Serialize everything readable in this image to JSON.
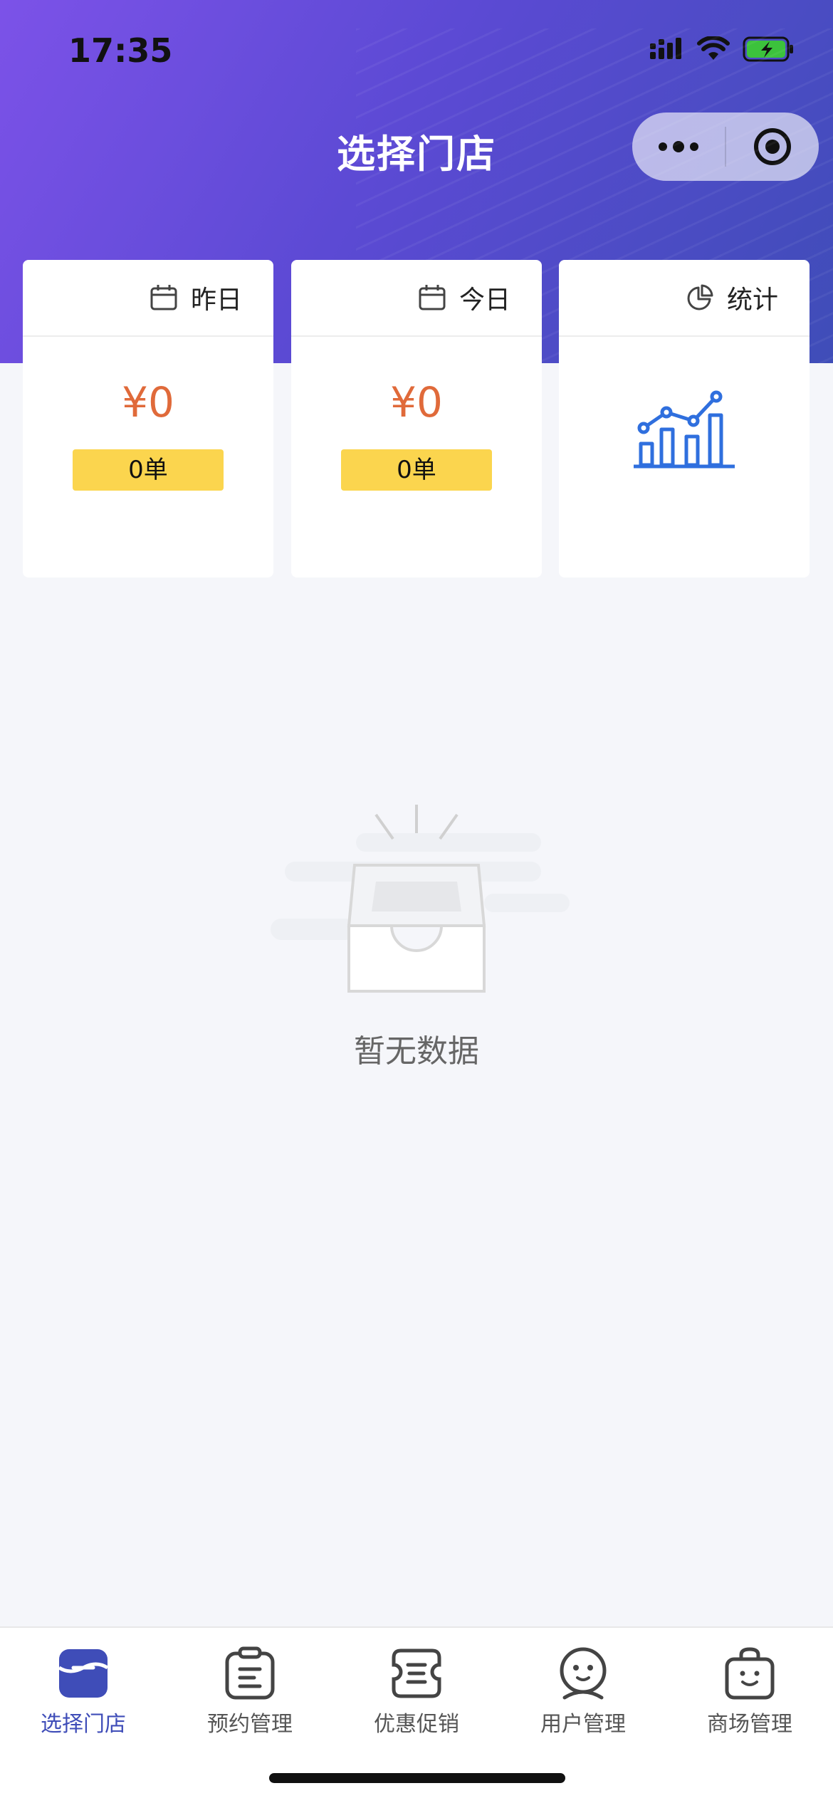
{
  "status_bar": {
    "time": "17:35"
  },
  "header": {
    "title": "选择门店"
  },
  "cards": [
    {
      "label": "昨日",
      "icon": "calendar-icon",
      "amount": "¥0",
      "orders": "0单"
    },
    {
      "label": "今日",
      "icon": "calendar-icon",
      "amount": "¥0",
      "orders": "0单"
    },
    {
      "label": "统计",
      "icon": "pie-chart-icon",
      "illustration": "bar-line-chart-icon"
    }
  ],
  "empty_state": {
    "text": "暂无数据"
  },
  "tabbar": {
    "items": [
      {
        "label": "选择门店",
        "icon": "store-icon",
        "active": true
      },
      {
        "label": "预约管理",
        "icon": "clipboard-icon",
        "active": false
      },
      {
        "label": "优惠促销",
        "icon": "ticket-icon",
        "active": false
      },
      {
        "label": "用户管理",
        "icon": "user-icon",
        "active": false
      },
      {
        "label": "商场管理",
        "icon": "shopping-bag-icon",
        "active": false
      }
    ]
  },
  "colors": {
    "header_start": "#7c52e8",
    "header_end": "#3f4db8",
    "amount": "#e06a3a",
    "orders_badge": "#fbd54e",
    "chart_blue": "#2f6fde",
    "tab_active": "#3f4db8"
  }
}
